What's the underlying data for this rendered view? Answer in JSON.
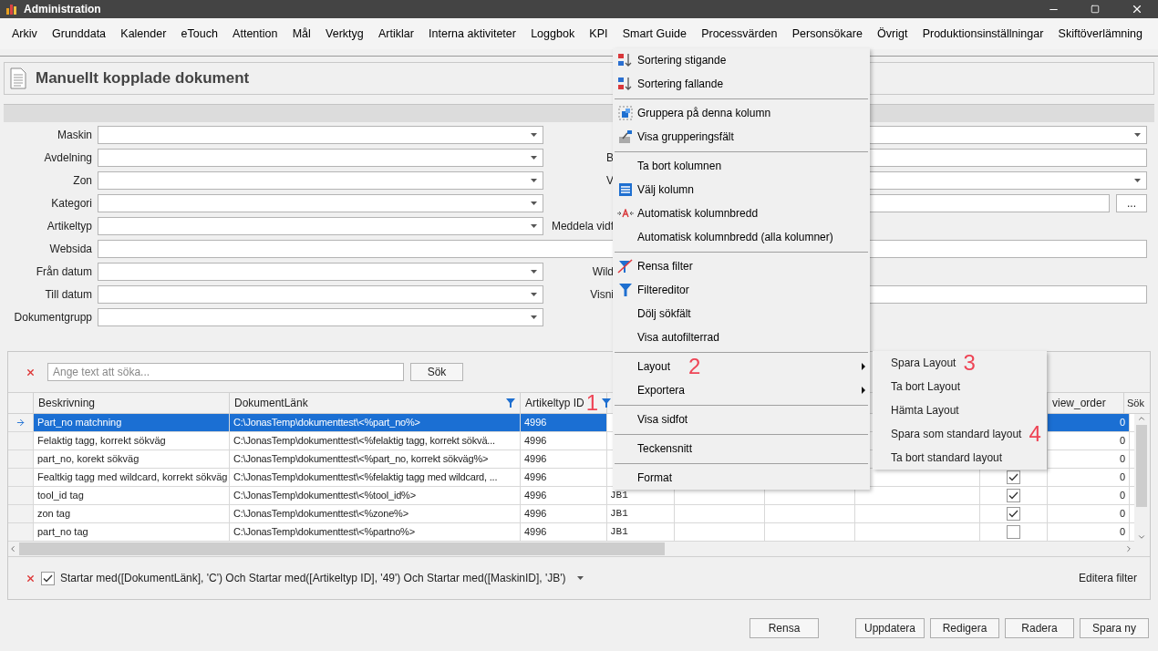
{
  "window": {
    "title": "Administration"
  },
  "menubar": [
    "Arkiv",
    "Grunddata",
    "Kalender",
    "eTouch",
    "Attention",
    "Mål",
    "Verktyg",
    "Artiklar",
    "Interna aktiviteter",
    "Loggbok",
    "KPI",
    "Smart Guide",
    "Processvärden",
    "Personsökare",
    "Övrigt",
    "Produktionsinställningar",
    "Skiftöverlämning"
  ],
  "page_title": "Manuellt kopplade dokument",
  "form": {
    "rows": [
      {
        "label": "Maskin",
        "kind": "dropdown",
        "right": {
          "kind": "dropdown"
        }
      },
      {
        "label": "Avdelning",
        "kind": "dropdown",
        "right": {
          "label": "B",
          "kind": "text"
        }
      },
      {
        "label": "Zon",
        "kind": "dropdown",
        "right": {
          "label": "V",
          "kind": "dropdown"
        }
      },
      {
        "label": "Kategori",
        "kind": "dropdown",
        "right": {
          "kind": "text_button",
          "button_label": "..."
        }
      },
      {
        "label": "Artikeltyp",
        "kind": "dropdown",
        "right": {
          "label": "Meddela vidf",
          "kind": "none"
        }
      },
      {
        "label": "Websida",
        "kind": "wide_text"
      },
      {
        "label": "Från datum",
        "kind": "dropdown",
        "right": {
          "label": "Wild",
          "kind": "none"
        }
      },
      {
        "label": "Till datum",
        "kind": "dropdown",
        "right": {
          "label": "Visni",
          "kind": "text"
        }
      },
      {
        "label": "Dokumentgrupp",
        "kind": "dropdown"
      }
    ]
  },
  "search": {
    "placeholder": "Ange text att söka...",
    "button": "Sök"
  },
  "table": {
    "columns": [
      {
        "label": "Beskrivning",
        "filtered": false
      },
      {
        "label": "DokumentLänk",
        "filtered": true
      },
      {
        "label": "Artikeltyp ID",
        "filtered": true,
        "marker": "1"
      },
      {
        "label": "view_order"
      },
      {
        "label": "Sök"
      }
    ],
    "rows": [
      {
        "selected": true,
        "beskrivning": "Part_no matchning",
        "dokumentlank": "C:\\JonasTemp\\dokumenttest\\<%part_no%>",
        "artikeltyp_id": "4996",
        "view_order": "0"
      },
      {
        "selected": false,
        "beskrivning": "Felaktig tagg, korrekt sökväg",
        "dokumentlank": "C:\\JonasTemp\\dokumenttest\\<%felaktig tagg, korrekt sökvä...",
        "artikeltyp_id": "4996",
        "view_order": "0"
      },
      {
        "selected": false,
        "beskrivning": "part_no, korekt sökväg",
        "dokumentlank": "C:\\JonasTemp\\dokumenttest\\<%part_no, korrekt sökväg%>",
        "artikeltyp_id": "4996",
        "view_order": "0"
      },
      {
        "selected": false,
        "beskrivning": "Fealtkig tagg med wildcard, korrekt sökväg",
        "dokumentlank": "C:\\JonasTemp\\dokumenttest\\<%felaktig tagg med wildcard, ...",
        "artikeltyp_id": "4996",
        "checked": true,
        "view_order": "0"
      },
      {
        "selected": false,
        "beskrivning": "tool_id tag",
        "dokumentlank": "C:\\JonasTemp\\dokumenttest\\<%tool_id%>",
        "artikeltyp_id": "4996",
        "column_5": "JB1",
        "checked": true,
        "view_order": "0"
      },
      {
        "selected": false,
        "beskrivning": "zon tag",
        "dokumentlank": "C:\\JonasTemp\\dokumenttest\\<%zone%>",
        "artikeltyp_id": "4996",
        "column_5": "JB1",
        "checked": true,
        "view_order": "0"
      },
      {
        "selected": false,
        "beskrivning": "part_no tag",
        "dokumentlank": "C:\\JonasTemp\\dokumenttest\\<%partno%>",
        "artikeltyp_id": "4996",
        "column_5": "JB1",
        "checked": false,
        "view_order": "0"
      }
    ]
  },
  "filter_bar": {
    "enabled": true,
    "text": "Startar med([DokumentLänk], 'C') Och Startar med([Artikeltyp ID], '49') Och Startar med([MaskinID], 'JB')",
    "edit_label": "Editera filter"
  },
  "buttons": [
    {
      "label": "Rensa"
    },
    {
      "label": "Uppdatera"
    },
    {
      "label": "Redigera"
    },
    {
      "label": "Radera"
    },
    {
      "label": "Spara ny"
    }
  ],
  "context_menu": {
    "groups": [
      [
        {
          "label": "Sortering stigande"
        },
        {
          "label": "Sortering fallande"
        }
      ],
      [
        {
          "label": "Gruppera på denna kolumn"
        },
        {
          "label": "Visa grupperingsfält"
        }
      ],
      [
        {
          "label": "Ta bort kolumnen"
        },
        {
          "label": "Välj kolumn"
        },
        {
          "label": "Automatisk kolumnbredd"
        },
        {
          "label": "Automatisk kolumnbredd (alla kolumner)"
        }
      ],
      [
        {
          "label": "Rensa filter"
        },
        {
          "label": "Filtereditor"
        },
        {
          "label": "Dölj sökfält"
        },
        {
          "label": "Visa autofilterrad"
        }
      ],
      [
        {
          "label": "Layout",
          "has_submenu": true,
          "marker": "2"
        },
        {
          "label": "Exportera",
          "has_submenu": true
        }
      ],
      [
        {
          "label": "Visa sidfot"
        }
      ],
      [
        {
          "label": "Teckensnitt"
        }
      ],
      [
        {
          "label": "Format"
        }
      ]
    ]
  },
  "submenu": [
    {
      "label": "Spara Layout",
      "marker": "3"
    },
    {
      "label": "Ta bort Layout"
    },
    {
      "label": "Hämta Layout"
    },
    {
      "label": "Spara som standard layout",
      "marker": "4"
    },
    {
      "label": "Ta bort standard layout"
    }
  ]
}
